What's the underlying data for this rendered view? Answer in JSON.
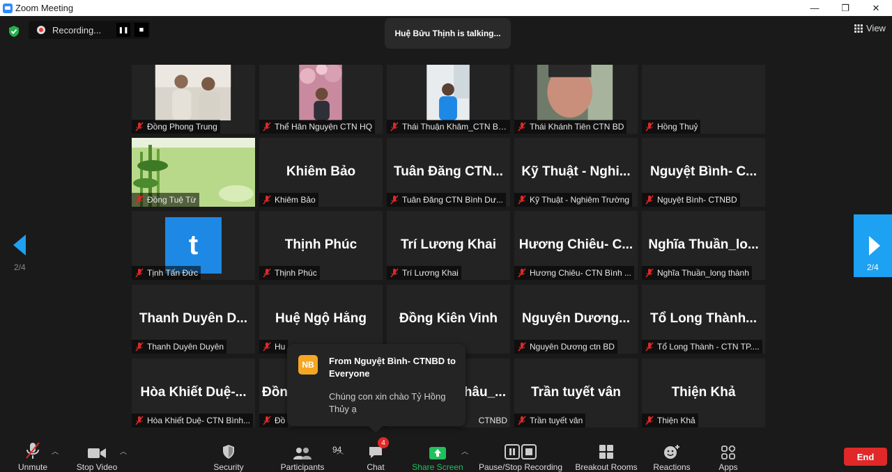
{
  "window": {
    "title": "Zoom Meeting",
    "minimize": "—",
    "restore": "❐",
    "close": "✕"
  },
  "recording": {
    "label": "Recording...",
    "pause": "❚❚",
    "stop": "■"
  },
  "talking": "Huệ Bửu Thịnh is talking...",
  "view_label": "View",
  "pager": {
    "left": "2/4",
    "right": "2/4"
  },
  "tiles": [
    {
      "big": "",
      "label": "Đồng Phong Trung"
    },
    {
      "big": "",
      "label": "Thể Hân Nguyện CTN HQ"
    },
    {
      "big": "",
      "label": "Thái Thuận Khâm_CTN Bì..."
    },
    {
      "big": "",
      "label": "Thái Khánh Tiên CTN BD"
    },
    {
      "big": "",
      "label": "Hồng Thuỷ"
    },
    {
      "big": "",
      "label": "Đồng Tuệ Từ"
    },
    {
      "big": "Khiêm Bảo",
      "label": "Khiêm Bảo"
    },
    {
      "big": "Tuân Đăng CTN...",
      "label": "Tuân Đăng CTN Bình Dư..."
    },
    {
      "big": "Kỹ Thuật - Nghi...",
      "label": "Kỹ Thuật - Nghiêm Trường"
    },
    {
      "big": "Nguyệt Bình- C...",
      "label": "Nguyệt Bình- CTNBD"
    },
    {
      "big": "",
      "label": "Tịnh Tấn Đức",
      "avatar": "t"
    },
    {
      "big": "Thịnh Phúc",
      "label": "Thịnh Phúc"
    },
    {
      "big": "Trí Lương Khai",
      "label": "Trí Lương Khai"
    },
    {
      "big": "Hương Chiêu- C...",
      "label": "Hương Chiêu- CTN Bình ..."
    },
    {
      "big": "Nghĩa Thuần_lo...",
      "label": "Nghĩa Thuần_long thành"
    },
    {
      "big": "Thanh Duyên D...",
      "label": "Thanh Duyên Duyên"
    },
    {
      "big": "Huệ Ngộ Hằng",
      "label": "Hu"
    },
    {
      "big": "Đồng Kiên Vinh",
      "label": ""
    },
    {
      "big": "Nguyên Dương...",
      "label": "Nguyên Dương ctn BD"
    },
    {
      "big": "Tổ Long Thành...",
      "label": "Tổ Long Thành - CTN TP...."
    },
    {
      "big": "Hòa Khiết Duệ-...",
      "label": "Hòa Khiết Duệ- CTN Bình..."
    },
    {
      "big": "Đồn",
      "label": "Đồ"
    },
    {
      "big": "hâu_...",
      "label": "CTNBD"
    },
    {
      "big": "Trần tuyết vân",
      "label": "Trần tuyết vân"
    },
    {
      "big": "Thiện Khả",
      "label": "Thiện Khả"
    }
  ],
  "chat_popup": {
    "initials": "NB",
    "from": "From Nguyệt Bình- CTNBD to Everyone",
    "message": "Chúng con xin chào Tỷ Hồng Thủy ạ"
  },
  "toolbar": {
    "unmute": "Unmute",
    "stop_video": "Stop Video",
    "security": "Security",
    "participants": "Participants",
    "participants_count": "94",
    "chat": "Chat",
    "chat_badge": "4",
    "share_screen": "Share Screen",
    "pause_stop_recording": "Pause/Stop Recording",
    "breakout_rooms": "Breakout Rooms",
    "reactions": "Reactions",
    "apps": "Apps",
    "end": "End"
  },
  "colors": {
    "share_green": "#20c05c",
    "end_red": "#e02828",
    "nav_blue": "#1da1f2"
  }
}
